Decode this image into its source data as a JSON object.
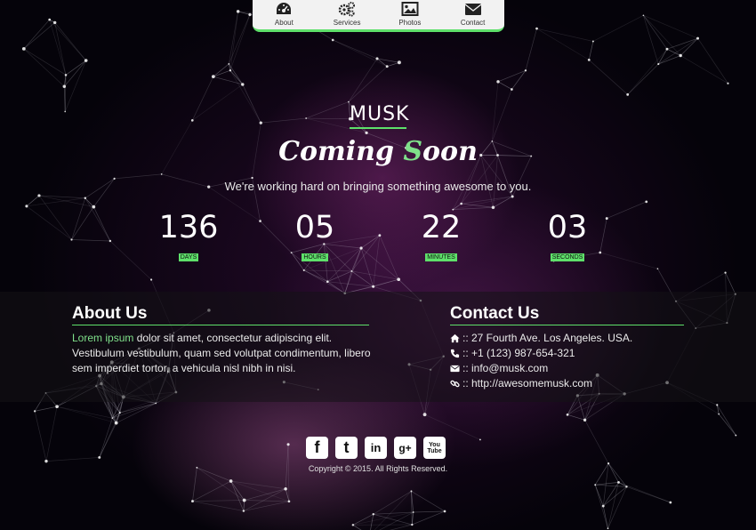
{
  "nav": {
    "items": [
      {
        "label": "About",
        "icon": "dashboard-icon"
      },
      {
        "label": "Services",
        "icon": "gears-icon"
      },
      {
        "label": "Photos",
        "icon": "picture-icon"
      },
      {
        "label": "Contact",
        "icon": "envelope-icon"
      }
    ]
  },
  "hero": {
    "brand": "MUSK",
    "headline_a": "Coming ",
    "headline_b": "S",
    "headline_c": "oon",
    "tagline": "We're working hard on bringing something awesome to you."
  },
  "countdown": [
    {
      "value": "136",
      "label": "DAYS"
    },
    {
      "value": "05",
      "label": "HOURS"
    },
    {
      "value": "22",
      "label": "MINUTES"
    },
    {
      "value": "03",
      "label": "SECONDS"
    }
  ],
  "about": {
    "title": "About Us",
    "highlight": "Lorem ipsum",
    "text": " dolor sit amet, consectetur adipiscing elit. Vestibulum vestibulum, quam sed volutpat condimentum, libero sem imperdiet tortor, a vehicula nisl nibh in nisi."
  },
  "contact": {
    "title": "Contact Us",
    "items": [
      {
        "icon": "home-icon",
        "text": ":: 27 Fourth Ave. Los Angeles. USA."
      },
      {
        "icon": "phone-icon",
        "text": ":: +1 (123) 987-654-321"
      },
      {
        "icon": "envelope-icon",
        "text": ":: info@musk.com"
      },
      {
        "icon": "link-icon",
        "text": ":: http://awesomemusk.com"
      }
    ]
  },
  "social": [
    {
      "icon": "facebook-icon",
      "glyph": "f"
    },
    {
      "icon": "twitter-icon",
      "glyph": "t"
    },
    {
      "icon": "linkedin-icon",
      "glyph": "in"
    },
    {
      "icon": "google-plus-icon",
      "glyph": "g+"
    },
    {
      "icon": "youtube-icon",
      "glyph": "You Tube"
    }
  ],
  "footer": {
    "copyright": "Copyright © 2015. All Rights Reserved."
  },
  "colors": {
    "accent": "#5ee06a",
    "background": "#06040a"
  }
}
